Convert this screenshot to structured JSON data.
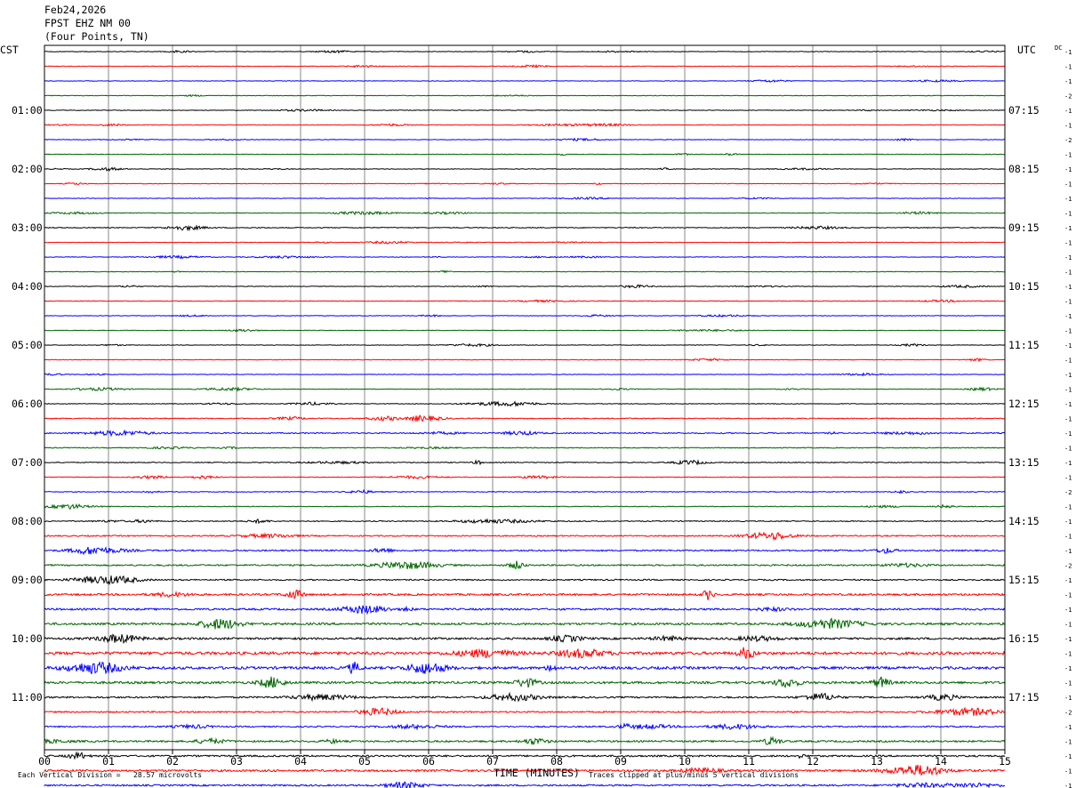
{
  "header": {
    "date": "Feb24,2026",
    "station": "FPST EHZ NM 00",
    "location": "(Four Points, TN)"
  },
  "axes": {
    "left_zone": "CST",
    "right_zone": "UTC",
    "dc_label": "DC",
    "xlabel": "TIME (MINUTES)"
  },
  "footer": {
    "scale_note": "Each Vertical Division =   28.57 microvolts",
    "clip_note": "Traces clipped at plus/minus 5 vertical divisions"
  },
  "chart_data": {
    "type": "line",
    "title": "FPST EHZ NM 00 (Four Points, TN)",
    "xlabel": "TIME (MINUTES)",
    "xlim": [
      0,
      15
    ],
    "x_ticks": [
      "00",
      "01",
      "02",
      "03",
      "04",
      "05",
      "06",
      "07",
      "08",
      "09",
      "10",
      "11",
      "12",
      "13",
      "14",
      "15"
    ],
    "grid": true,
    "minutes_per_line": 15,
    "trace_colors": [
      "#000000",
      "#ff0000",
      "#0000ff",
      "#006400"
    ],
    "left_hour_labels": [
      "01:00",
      "02:00",
      "03:00",
      "04:00",
      "05:00",
      "06:00",
      "07:00",
      "08:00",
      "09:00",
      "10:00",
      "11:00"
    ],
    "right_hour_labels": [
      "07:15",
      "08:15",
      "09:15",
      "10:15",
      "11:15",
      "12:15",
      "13:15",
      "14:15",
      "15:15",
      "16:15",
      "17:15"
    ],
    "dc_offsets": [
      -1,
      -1,
      -1,
      -2,
      -1,
      -1,
      -2,
      -1,
      -1,
      -1,
      -1,
      -1,
      -1,
      -1,
      -1,
      -1,
      -1,
      -1,
      -1,
      -1,
      -1,
      -1,
      -1,
      -1,
      -1,
      -1,
      -1,
      -1,
      -1,
      -1,
      -2,
      -1,
      -1,
      -1,
      -1,
      -2,
      -1,
      -1,
      -1,
      -1,
      -1,
      -1,
      -1,
      -1,
      -1,
      -2,
      -1,
      -1,
      -1,
      -1,
      -1
    ],
    "line_activity": [
      0.5,
      0.45,
      0.45,
      0.5,
      0.5,
      0.45,
      0.45,
      0.5,
      0.55,
      0.45,
      0.45,
      0.55,
      0.8,
      0.45,
      0.45,
      0.5,
      0.5,
      0.55,
      0.45,
      0.45,
      0.45,
      0.45,
      0.45,
      0.55,
      0.55,
      0.9,
      1.0,
      0.8,
      0.8,
      0.6,
      0.7,
      0.7,
      0.9,
      1.1,
      1.3,
      1.4,
      1.2,
      1.8,
      1.7,
      2.0,
      1.9,
      2.6,
      2.4,
      2.1,
      1.5,
      1.3,
      1.2,
      1.6,
      1.6,
      1.9,
      1.5
    ]
  }
}
